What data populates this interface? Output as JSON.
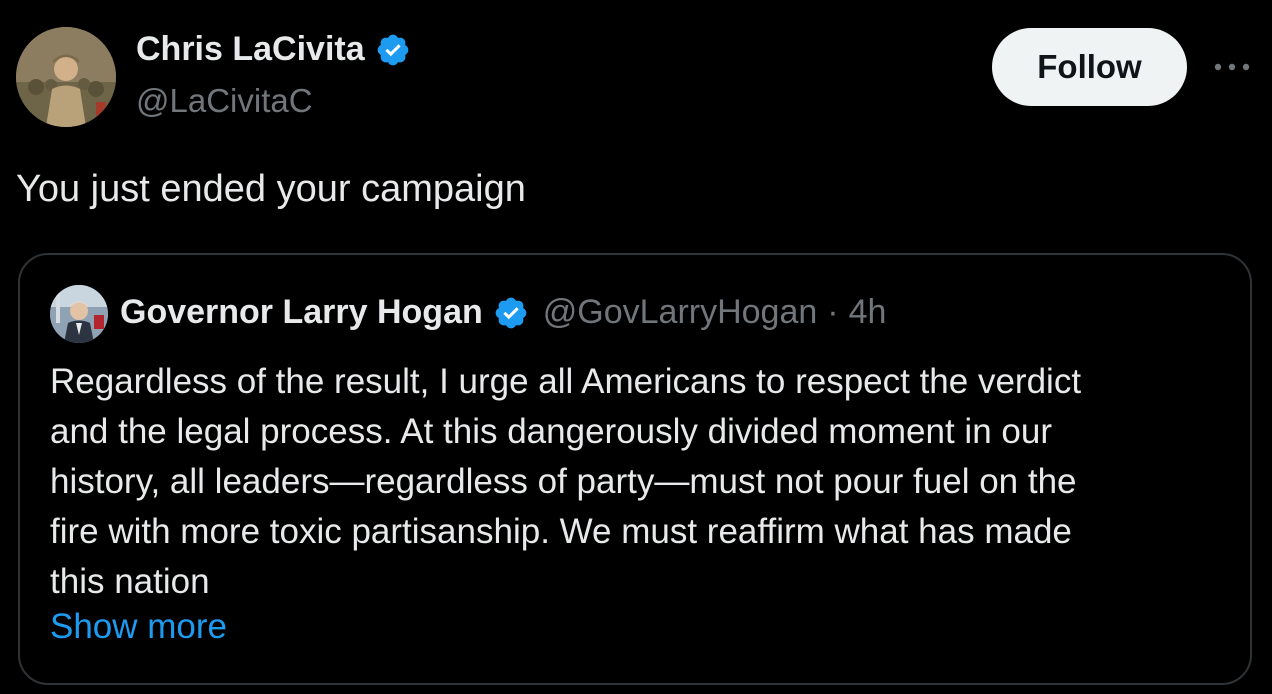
{
  "author": {
    "name": "Chris LaCivita",
    "handle": "@LaCivitaC",
    "verified": true
  },
  "actions": {
    "follow_label": "Follow"
  },
  "tweet": {
    "text": "You just ended your campaign"
  },
  "quoted": {
    "name": "Governor Larry Hogan",
    "handle": "@GovLarryHogan",
    "separator": "·",
    "time": "4h",
    "verified": true,
    "lines": [
      "Regardless of the result, I urge all Americans to respect the verdict",
      "and the legal process. At this dangerously divided moment in our",
      "history, all leaders—regardless of party—must not pour fuel on the",
      "fire with more toxic partisanship. We must reaffirm what has made",
      "this nation"
    ],
    "show_more_label": "Show more"
  },
  "colors": {
    "background": "#000000",
    "text_primary": "#e7e9ea",
    "text_secondary": "#71767b",
    "accent_blue": "#1d9bf0",
    "follow_bg": "#eff3f4",
    "border": "#2f3336"
  },
  "icons": {
    "verified": "verified-badge-icon",
    "more": "more-horizontal-icon"
  }
}
